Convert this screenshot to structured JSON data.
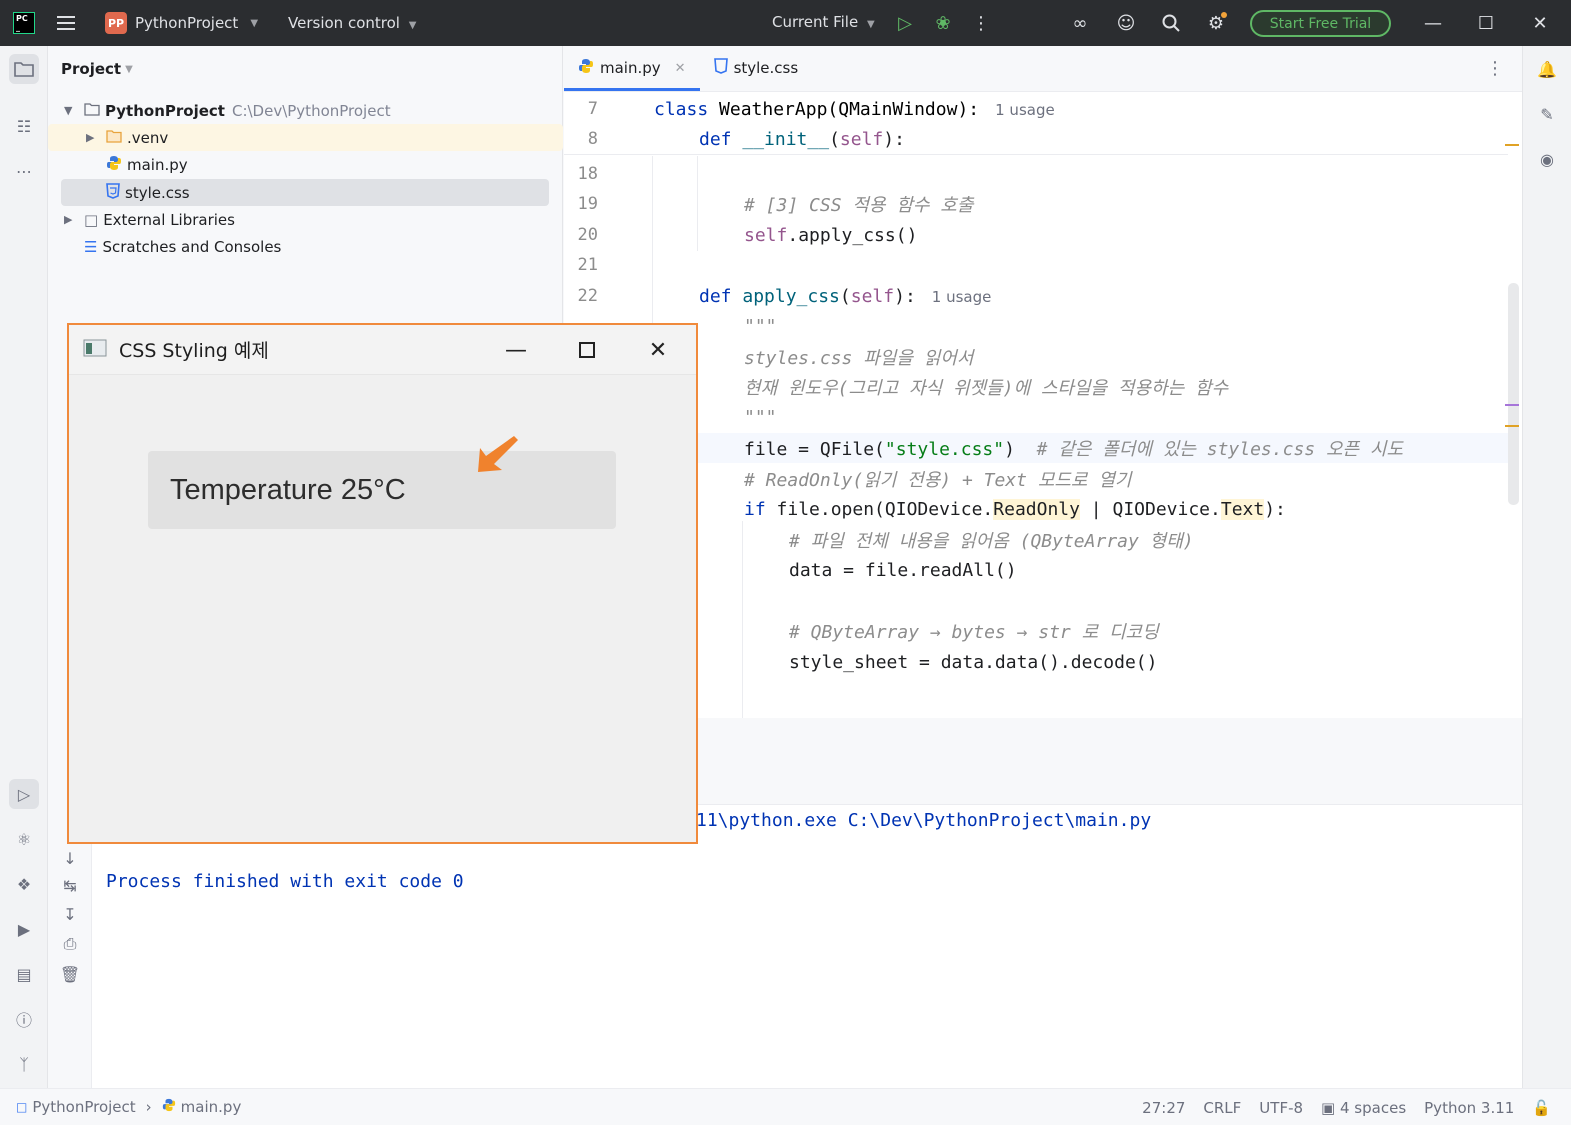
{
  "titlebar": {
    "project_badge": "PP",
    "project_name": "PythonProject",
    "version_control": "Version control",
    "run_config": "Current File",
    "trial_button": "Start Free Trial"
  },
  "project_panel": {
    "title": "Project",
    "tree": [
      {
        "label": "PythonProject",
        "path": "C:\\Dev\\PythonProject"
      },
      {
        "label": ".venv"
      },
      {
        "label": "main.py"
      },
      {
        "label": "style.css"
      },
      {
        "label": "External Libraries"
      },
      {
        "label": "Scratches and Consoles"
      }
    ]
  },
  "editor": {
    "tabs": [
      {
        "label": "main.py",
        "active": true
      },
      {
        "label": "style.css",
        "active": false
      }
    ],
    "warnings_count": "3",
    "usage_1": "1 usage",
    "usage_2": "1 usage",
    "line_numbers": [
      "7",
      "8",
      "18",
      "19",
      "20",
      "21",
      "22"
    ],
    "code": {
      "l7_kw": "class",
      "l7_name": "WeatherApp(QMainWindow):",
      "l8_kw": "def",
      "l8_fn": "__init__",
      "l8_open": "(",
      "l8_self": "self",
      "l8_close": "):",
      "l19_cmt": "# [3] CSS 적용 함수 호출",
      "l20_self": "self",
      "l20_rest": ".apply_css()",
      "l22_kw": "def",
      "l22_fn": "apply_css",
      "l22_open": "(",
      "l22_self": "self",
      "l22_close": "):",
      "doc_open": "\"\"\"",
      "doc_1": "styles.css 파일을 읽어서",
      "doc_2": "현재 윈도우(그리고 자식 위젯들)에 스타일을 적용하는 함수",
      "doc_close": "\"\"\"",
      "file_prefix": "file = QFile(",
      "file_str": "\"style.css\"",
      "file_suffix": ")",
      "file_cmt": "# 같은 폴더에 있는 styles.css 오픈 시도",
      "readonly_cmt": "# ReadOnly(읽기 전용) + Text 모드로 열기",
      "if_kw": "if",
      "if_part1": " file.open(QIODevice.",
      "if_readonly": "ReadOnly",
      "if_part2": " | QIODevice.",
      "if_text": "Text",
      "if_part3": "):",
      "read_cmt": "# 파일 전체 내용을 읽어옴 (QByteArray 형태)",
      "data_line": "data = file.readAll()",
      "decode_cmt": "# QByteArray → bytes → str 로 디코딩",
      "style_line": "style_sheet = data.data().decode()"
    }
  },
  "console": {
    "command": "11\\python.exe C:\\Dev\\PythonProject\\main.py",
    "finished": "Process finished with exit code 0"
  },
  "qt_window": {
    "title": "CSS Styling 예제",
    "label": "Temperature 25°C",
    "arrow_color": "#f0822d"
  },
  "statusbar": {
    "crumb_project": "PythonProject",
    "crumb_file": "main.py",
    "position": "27:27",
    "line_sep": "CRLF",
    "encoding": "UTF-8",
    "indent": "4 spaces",
    "interpreter": "Python 3.11"
  }
}
